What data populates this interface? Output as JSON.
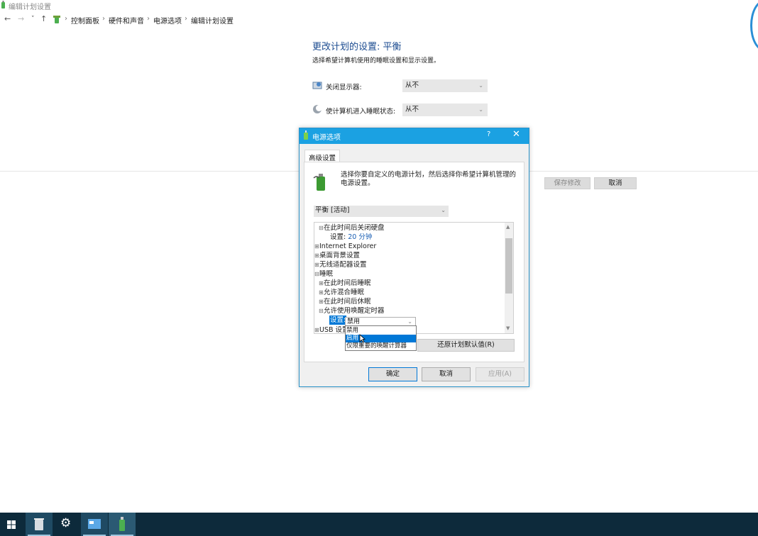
{
  "window": {
    "title": "编辑计划设置"
  },
  "nav": {
    "back": "←",
    "forward": "→",
    "history": "˅",
    "up": "↑",
    "breadcrumb": [
      "控制面板",
      "硬件和声音",
      "电源选项",
      "编辑计划设置"
    ],
    "separator": "›"
  },
  "page": {
    "heading": "更改计划的设置: 平衡",
    "subtitle": "选择希望计算机使用的睡眠设置和显示设置。",
    "display_off": {
      "label": "关闭显示器:",
      "value": "从不"
    },
    "sleep": {
      "label": "使计算机进入睡眠状态:",
      "value": "从不"
    },
    "save_button": "保存修改",
    "cancel_button": "取消"
  },
  "dialog": {
    "title": "电源选项",
    "help": "?",
    "close": "✕",
    "tab": "高级设置",
    "description": "选择你要自定义的电源计划，然后选择你希望计算机管理的电源设置。",
    "plan_select": "平衡 [活动]",
    "tree": [
      {
        "sign": "⊟",
        "text": "在此时间后关闭硬盘"
      },
      {
        "prefix": "设置:",
        "value": "20 分钟"
      },
      {
        "sign": "⊞",
        "text": "Internet Explorer"
      },
      {
        "sign": "⊞",
        "text": "桌面背景设置"
      },
      {
        "sign": "⊞",
        "text": "无线适配器设置"
      },
      {
        "sign": "⊟",
        "text": "睡眠"
      },
      {
        "sign": "⊞",
        "text": "在此时间后睡眠"
      },
      {
        "sign": "⊞",
        "text": "允许混合睡眠"
      },
      {
        "sign": "⊞",
        "text": "在此时间后休眠"
      },
      {
        "sign": "⊟",
        "text": "允许使用唤醒定时器"
      },
      {
        "sign": "⊞",
        "text": "USB 设置"
      }
    ],
    "setting_label": "设置:",
    "combo_value": "禁用",
    "dropdown_options": [
      "禁用",
      "启用",
      "仅限重要的唤醒计算器"
    ],
    "dropdown_selected": "启用",
    "restore_button": "还原计划默认值(R)",
    "ok_button": "确定",
    "cancel_button": "取消",
    "apply_button": "应用(A)"
  },
  "taskbar": {
    "icons": [
      "windows-start-icon",
      "recycle-bin-icon",
      "settings-gear-icon",
      "control-panel-icon",
      "power-options-icon"
    ]
  },
  "colors": {
    "accent": "#1ba1e2",
    "heading": "#1b4b90",
    "taskbar": "#0d2a3b",
    "selection": "#0078d7"
  }
}
